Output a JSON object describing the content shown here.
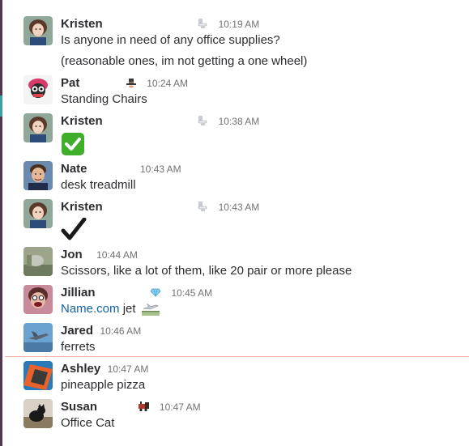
{
  "channel": {
    "messages": [
      {
        "author": "Kristen",
        "status": "toilet-icon",
        "time": "10:19 AM",
        "lines": [
          "Is anyone in need of any office supplies?",
          "(reasonable ones, im not getting a one wheel)"
        ]
      },
      {
        "author": "Pat",
        "status": "hat-icon",
        "time": "10:24 AM",
        "lines": [
          "Standing Chairs"
        ]
      },
      {
        "author": "Kristen",
        "status": "toilet-icon",
        "time": "10:38 AM",
        "lines": [
          "✅"
        ]
      },
      {
        "author": "Nate",
        "status": "",
        "time": "10:43 AM",
        "lines": [
          "desk treadmill"
        ]
      },
      {
        "author": "Kristen",
        "status": "toilet-icon",
        "time": "10:43 AM",
        "lines": [
          "✔"
        ]
      },
      {
        "author": "Jon",
        "status": "",
        "time": "10:44 AM",
        "lines": [
          "Scissors, like a lot of them, like 20 pair or more please"
        ]
      },
      {
        "author": "Jillian",
        "status": "gem-icon",
        "time": "10:45 AM",
        "link": "Name.com",
        "link_suffix": " jet",
        "lines": []
      },
      {
        "author": "Jared",
        "status": "",
        "time": "10:46 AM",
        "lines": [
          "ferrets"
        ]
      },
      {
        "author": "Ashley",
        "status": "",
        "time": "10:47 AM",
        "lines": [
          "pineapple pizza"
        ]
      },
      {
        "author": "Susan",
        "status": "train-icon",
        "time": "10:47 AM",
        "lines": [
          "Office Cat"
        ]
      }
    ]
  },
  "colors": {
    "sidebar": "#4d394b",
    "link": "#1264a3",
    "new_messages_divider": "#f2b4aa",
    "check_green": "#3fae2a"
  }
}
